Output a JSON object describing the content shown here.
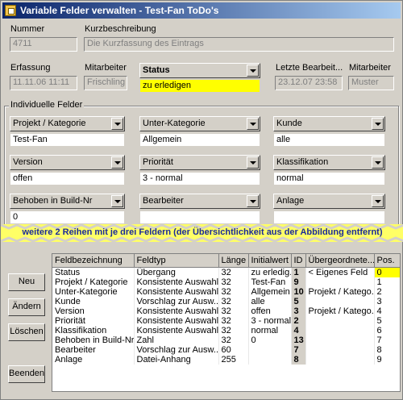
{
  "window": {
    "title": "Variable Felder verwalten - Test-Fan  ToDo's"
  },
  "header": {
    "nummer_label": "Nummer",
    "nummer_value": "4711",
    "kurz_label": "Kurzbeschreibung",
    "kurz_value": "Die Kurzfassung des Eintrags",
    "erfassung_label": "Erfassung",
    "erfassung_value": "11.11.06  11:11",
    "mitarbeiter1_label": "Mitarbeiter",
    "mitarbeiter1_value": "Frischling",
    "status_label": "Status",
    "status_value": "zu erledigen",
    "letzte_label": "Letzte Bearbeit...",
    "letzte_value": "23.12.07  23:58",
    "mitarbeiter2_label": "Mitarbeiter",
    "mitarbeiter2_value": "Muster"
  },
  "individual": {
    "group_label": "Individuelle Felder",
    "fields": [
      {
        "label": "Projekt / Kategorie",
        "value": "Test-Fan"
      },
      {
        "label": "Unter-Kategorie",
        "value": "Allgemein"
      },
      {
        "label": "Kunde",
        "value": "alle"
      },
      {
        "label": "Version",
        "value": "offen"
      },
      {
        "label": "Priorität",
        "value": "3 - normal"
      },
      {
        "label": "Klassifikation",
        "value": "normal"
      },
      {
        "label": "Behoben in Build-Nr",
        "value": "0"
      },
      {
        "label": "Bearbeiter",
        "value": ""
      },
      {
        "label": "Anlage",
        "value": ""
      }
    ]
  },
  "banner": "weitere 2 Reihen mit je drei Feldern (der Übersichtlichkeit aus der Abbildung entfernt)",
  "buttons": {
    "neu": "Neu",
    "aendern": "Ändern",
    "loeschen": "Löschen",
    "beenden": "Beenden"
  },
  "table": {
    "columns": [
      "Feldbezeichnung",
      "Feldtyp",
      "Länge",
      "Initialwert",
      "ID",
      "Übergeordnete...",
      "Pos."
    ],
    "rows": [
      [
        "Status",
        "Übergang",
        "32",
        "zu erledig...",
        "1",
        "< Eigenes Feld",
        "0"
      ],
      [
        "Projekt / Kategorie",
        "Konsistente Auswahl",
        "32",
        "Test-Fan",
        "9",
        "",
        "1"
      ],
      [
        "Unter-Kategorie",
        "Konsistente Auswahl",
        "32",
        "Allgemein",
        "10",
        "Projekt / Katego...",
        "2"
      ],
      [
        "Kunde",
        "Vorschlag zur Ausw...",
        "32",
        "alle",
        "5",
        "",
        "3"
      ],
      [
        "Version",
        "Konsistente Auswahl",
        "32",
        "offen",
        "3",
        "Projekt / Katego...",
        "4"
      ],
      [
        "Priorität",
        "Konsistente Auswahl",
        "32",
        "3 - normal",
        "2",
        "",
        "5"
      ],
      [
        "Klassifikation",
        "Konsistente Auswahl",
        "32",
        "normal",
        "4",
        "",
        "6"
      ],
      [
        "Behoben in Build-Nr",
        "Zahl",
        "32",
        "0",
        "13",
        "",
        "7"
      ],
      [
        "Bearbeiter",
        "Vorschlag zur Ausw...",
        "60",
        "",
        "7",
        "",
        "8"
      ],
      [
        "Anlage",
        "Datei-Anhang",
        "255",
        "",
        "8",
        "",
        "9"
      ]
    ]
  }
}
